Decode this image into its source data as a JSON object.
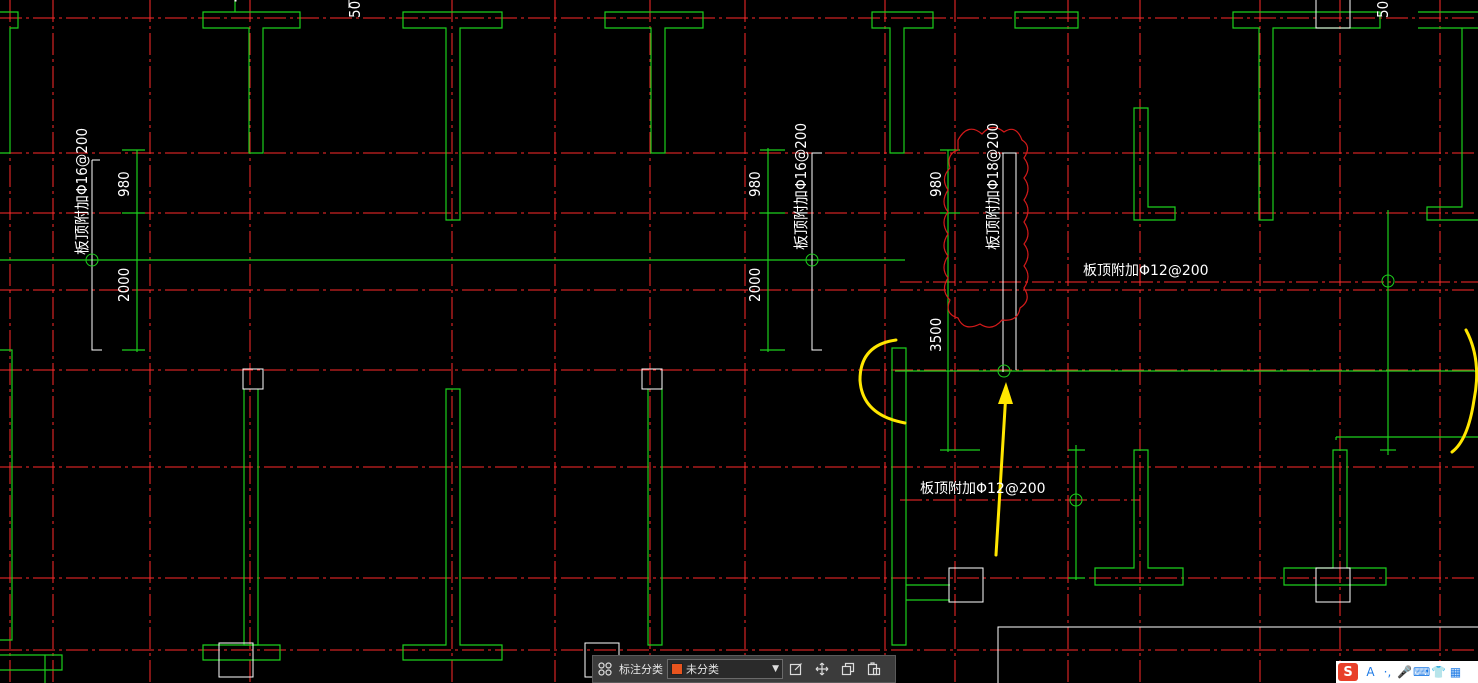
{
  "canvas": {
    "background": "#000000",
    "colors": {
      "axis_line": "#ff2a2a",
      "wall": "#1ccf1c",
      "text": "#ffffff",
      "highlight": "#ffe600",
      "revision_cloud": "#d41a1a"
    }
  },
  "annotations": {
    "rebar_1": "板顶附加Φ16@200",
    "rebar_2": "板顶附加Φ16@200",
    "rebar_3": "板顶附加Φ18@200",
    "rebar_4": "板顶附加Φ12@200",
    "rebar_5": "板顶附加Φ12@200",
    "dim_980_a": "980",
    "dim_2000_a": "2000",
    "dim_980_b": "980",
    "dim_2000_b": "2000",
    "dim_980_c": "980",
    "dim_3500": "3500",
    "dim_top_a": "50",
    "dim_top_b": "50"
  },
  "toolbar": {
    "grid_icon": "grid-icon",
    "category_label": "标注分类",
    "category_value": "未分类",
    "category_color": "#e8541e",
    "buttons": [
      "edit-icon",
      "move-icon",
      "copy-icon",
      "paste-icon"
    ]
  },
  "ime": {
    "logo": "S",
    "items": [
      "A",
      "·,",
      "mic-icon",
      "keyboard-icon",
      "shirt-icon",
      "grid-icon"
    ],
    "item_text": [
      "A",
      "·,",
      "🎤",
      "⌨",
      "👕",
      "▦"
    ]
  }
}
